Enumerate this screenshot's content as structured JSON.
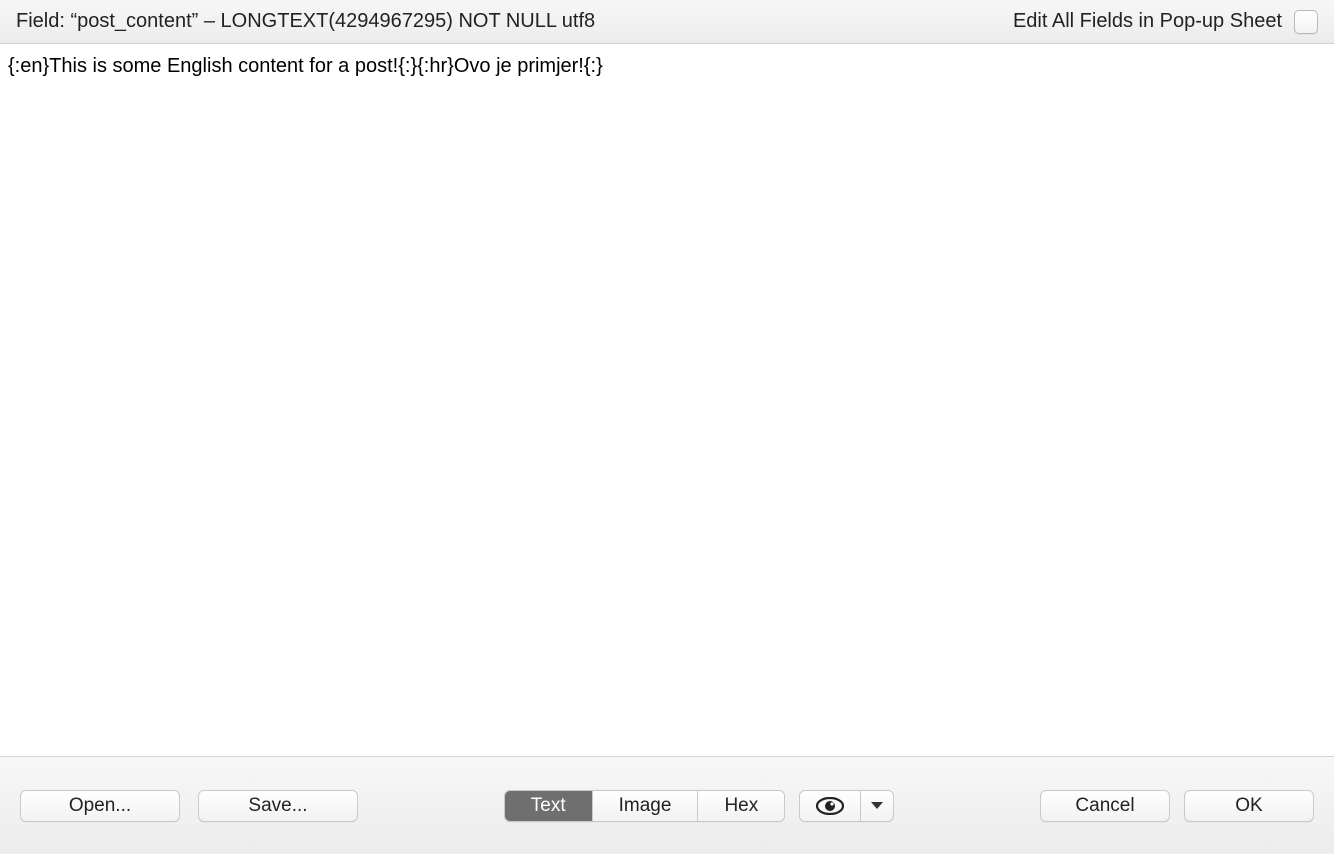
{
  "header": {
    "field_label": "Field: “post_content” – LONGTEXT(4294967295) NOT NULL utf8",
    "edit_all_label": "Edit All Fields in Pop-up Sheet"
  },
  "content": {
    "text": "{:en}This is some English content for a post!{:}{:hr}Ovo je primjer!{:}"
  },
  "footer": {
    "open_label": "Open...",
    "save_label": "Save...",
    "segments": {
      "text": "Text",
      "image": "Image",
      "hex": "Hex"
    },
    "cancel_label": "Cancel",
    "ok_label": "OK"
  }
}
